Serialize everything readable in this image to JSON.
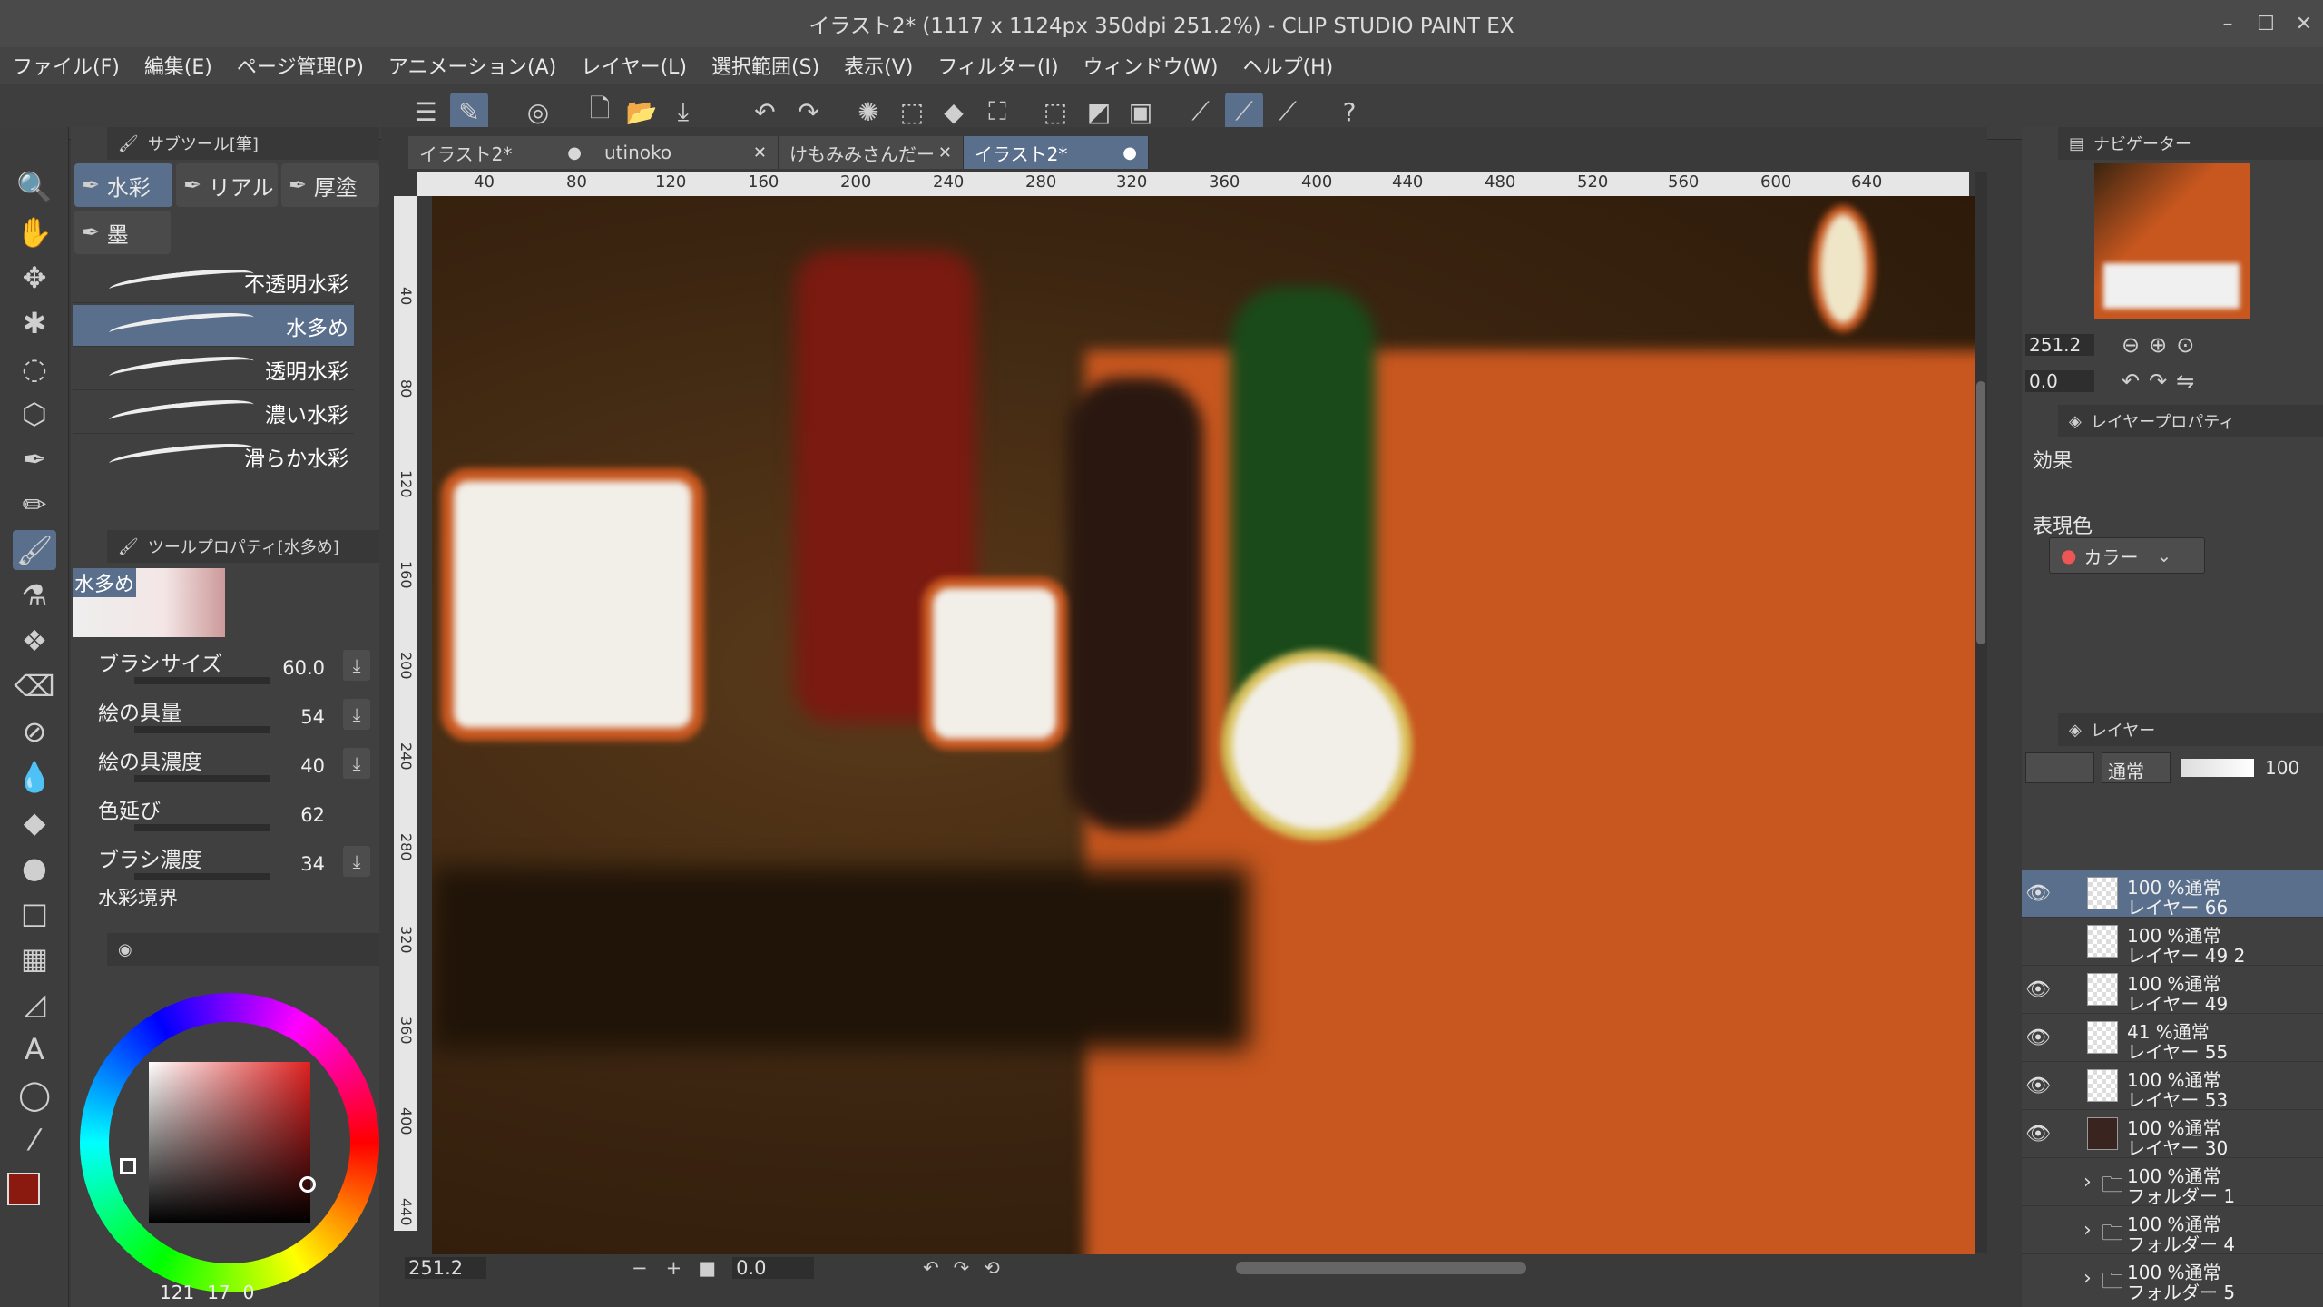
{
  "window": {
    "title": "イラスト2* (1117 x 1124px 350dpi 251.2%)  - CLIP STUDIO PAINT EX"
  },
  "menu": [
    "ファイル(F)",
    "編集(E)",
    "ページ管理(P)",
    "アニメーション(A)",
    "レイヤー(L)",
    "選択範囲(S)",
    "表示(V)",
    "フィルター(I)",
    "ウィンドウ(W)",
    "ヘルプ(H)"
  ],
  "subtool": {
    "header": "サブツール[筆]",
    "tabs": [
      "水彩",
      "リアル",
      "厚塗",
      "墨"
    ],
    "brushes": [
      "不透明水彩",
      "水多め",
      "透明水彩",
      "濃い水彩",
      "滑らか水彩"
    ],
    "selected_brush": "水多め"
  },
  "toolprop": {
    "header": "ツールプロパティ[水多め]",
    "preview_label": "水多め",
    "rows": [
      {
        "label": "ブラシサイズ",
        "value": "60.0"
      },
      {
        "label": "絵の具量",
        "value": "54"
      },
      {
        "label": "絵の具濃度",
        "value": "40"
      },
      {
        "label": "色延び",
        "value": "62"
      },
      {
        "label": "ブラシ濃度",
        "value": "34"
      }
    ],
    "cutoff": "水彩境界"
  },
  "color": {
    "r": "121",
    "g": "17",
    "b": "0",
    "main_color": "#8a1a10"
  },
  "doc_tabs": [
    "イラスト2*",
    "utinoko",
    "けもみみさんだー",
    "イラスト2*"
  ],
  "ruler": {
    "top": [
      "40",
      "80",
      "120",
      "160",
      "200",
      "240",
      "280",
      "320",
      "360",
      "400",
      "440",
      "480",
      "520",
      "560",
      "600",
      "640"
    ],
    "left": [
      "40",
      "80",
      "120",
      "160",
      "200",
      "240",
      "280",
      "320",
      "360",
      "400",
      "440"
    ]
  },
  "status": {
    "zoom": "251.2",
    "angle": "0.0"
  },
  "navigator": {
    "title": "ナビゲーター",
    "zoom": "251.2",
    "angle": "0.0"
  },
  "layerprop": {
    "title": "レイヤープロパティ",
    "effect": "効果",
    "expr_color": "表現色",
    "color_mode": "カラー"
  },
  "layers": {
    "title": "レイヤー",
    "blend": "通常",
    "opacity": "100",
    "items": [
      {
        "l1": "100 %通常",
        "l2": "レイヤー 66",
        "sel": true,
        "eye": true,
        "type": "layer"
      },
      {
        "l1": "100 %通常",
        "l2": "レイヤー 49 2",
        "sel": false,
        "eye": false,
        "type": "layer"
      },
      {
        "l1": "100 %通常",
        "l2": "レイヤー 49",
        "sel": false,
        "eye": true,
        "type": "layer"
      },
      {
        "l1": "41 %通常",
        "l2": "レイヤー 55",
        "sel": false,
        "eye": true,
        "type": "layer"
      },
      {
        "l1": "100 %通常",
        "l2": "レイヤー 53",
        "sel": false,
        "eye": true,
        "type": "layer"
      },
      {
        "l1": "100 %通常",
        "l2": "レイヤー 30",
        "sel": false,
        "eye": true,
        "type": "layer"
      },
      {
        "l1": "100 %通常",
        "l2": "フォルダー 1",
        "sel": false,
        "eye": false,
        "type": "folder"
      },
      {
        "l1": "100 %通常",
        "l2": "フォルダー 4",
        "sel": false,
        "eye": false,
        "type": "folder"
      },
      {
        "l1": "100 %通常",
        "l2": "フォルダー 5",
        "sel": false,
        "eye": false,
        "type": "folder"
      }
    ]
  }
}
